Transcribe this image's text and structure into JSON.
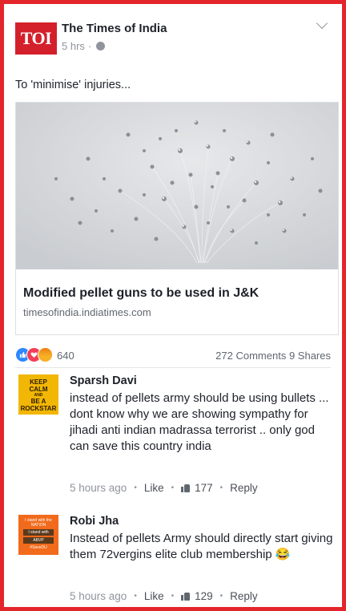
{
  "post": {
    "page_name": "The Times of India",
    "logo_text": "TOI",
    "time": "5 hrs",
    "separator": "·",
    "text": "To 'minimise' injuries..."
  },
  "link": {
    "title": "Modified pellet guns to be used in J&K",
    "domain": "timesofindia.indiatimes.com"
  },
  "reactions": {
    "count": "640",
    "comments": "272 Comments",
    "shares": "9 Shares",
    "types": [
      "like-icon",
      "love-icon",
      "angry-icon"
    ]
  },
  "comments": [
    {
      "author": "Sparsh Davi",
      "avatar_lines": [
        "KEEP",
        "CALM",
        "AND",
        "BE A",
        "ROCKSTAR"
      ],
      "text": "instead of pellets army should be using bullets ... dont know why we are  showing sympathy for jihadi  anti indian madrassa terrorist .. only god can save this country india",
      "time": "5 hours ago",
      "like_label": "Like",
      "like_count": "177",
      "reply_label": "Reply"
    },
    {
      "author": "Robi Jha",
      "avatar_lines": [
        "I stand with the",
        "NATION",
        "I stand with",
        "ABVP",
        "#SaveDU"
      ],
      "text": "Instead of pellets Army should directly start giving them 72vergins elite club membership 😂",
      "time": "5 hours ago",
      "like_label": "Like",
      "like_count": "129",
      "reply_label": "Reply"
    }
  ],
  "colors": {
    "frame": "#e3262b",
    "logo": "#d4202b",
    "like": "#2d88ff",
    "love": "#f33e58",
    "angry": "#f7b125"
  }
}
